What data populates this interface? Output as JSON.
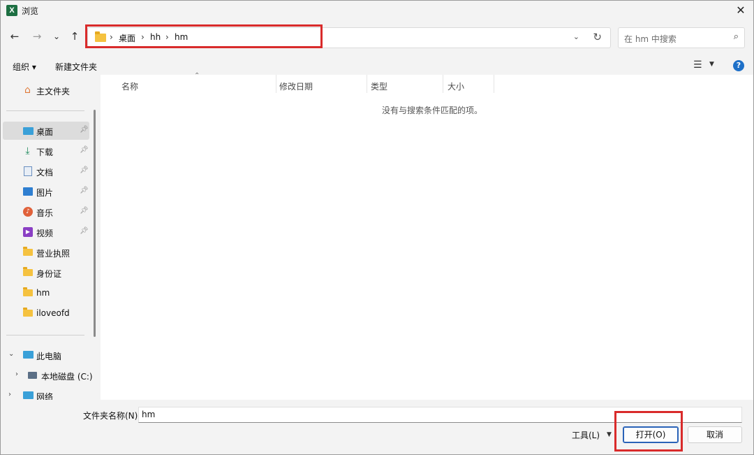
{
  "titlebar": {
    "title": "浏览",
    "close": "✕"
  },
  "nav": {
    "back": "←",
    "forward": "→",
    "history": "⌄",
    "up": "↑",
    "breadcrumb": [
      "桌面",
      "hh",
      "hm"
    ],
    "separator": "›",
    "dropdown": "⌄",
    "refresh": "↻"
  },
  "search": {
    "placeholder": "在 hm 中搜索",
    "icon": "⌕"
  },
  "toolbar": {
    "organize": "组织 ▾",
    "new_folder": "新建文件夹",
    "help": "?"
  },
  "sidebar": {
    "home": "主文件夹",
    "quick": [
      {
        "label": "桌面",
        "icon": "desktop-icon",
        "pinned": true
      },
      {
        "label": "下载",
        "icon": "download-icon",
        "pinned": true
      },
      {
        "label": "文档",
        "icon": "document-icon",
        "pinned": true
      },
      {
        "label": "图片",
        "icon": "picture-icon",
        "pinned": true
      },
      {
        "label": "音乐",
        "icon": "music-icon",
        "pinned": true
      },
      {
        "label": "视频",
        "icon": "video-icon",
        "pinned": true
      }
    ],
    "folders": [
      "营业执照",
      "身份证",
      "hm",
      "iloveofd"
    ],
    "this_pc": "此电脑",
    "local_disk": "本地磁盘 (C:)",
    "network": "网络"
  },
  "list": {
    "columns": [
      "名称",
      "修改日期",
      "类型",
      "大小"
    ],
    "empty_message": "没有与搜索条件匹配的项。"
  },
  "footer": {
    "folder_name_label": "文件夹名称(N):",
    "folder_name_value": "hm",
    "tools": "工具(L)",
    "open": "打开(O)",
    "cancel": "取消"
  },
  "colors": {
    "highlight": "#d92b2b",
    "accent": "#2a63b8",
    "folder": "#f5c240"
  }
}
